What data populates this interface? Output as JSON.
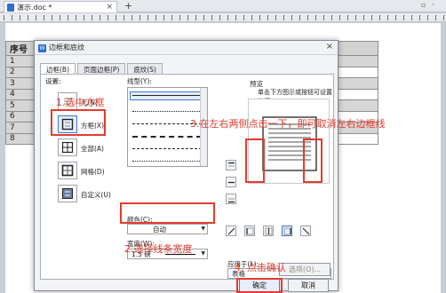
{
  "tabbar": {
    "doc_name": "演示.doc *",
    "new_tab": "+"
  },
  "document": {
    "header": [
      "序号",
      "",
      "",
      "",
      "",
      "数"
    ],
    "rows": [
      "1",
      "2",
      "3",
      "4",
      "5",
      "6",
      "7",
      "8"
    ]
  },
  "dialog": {
    "title": "边框和底纹",
    "tabs": [
      "边框(B)",
      "页面边框(P)",
      "底纹(S)"
    ],
    "settings_label": "设置:",
    "settings": [
      "无(N)",
      "方框(X)",
      "全部(A)",
      "网格(D)",
      "自定义(U)"
    ],
    "linestyle_label": "线型(Y):",
    "color_label": "颜色(C):",
    "color_value": "自动",
    "width_label": "宽度(W):",
    "width_value": "1.5 磅",
    "preview_label": "预览",
    "preview_hint": "单击下方图示或按钮可设置边框",
    "apply_label": "应用于(L):",
    "apply_value": "表格",
    "options_label": "选项(O)...",
    "ok_label": "确定",
    "cancel_label": "取消"
  },
  "annotations": {
    "step1": "1.选中方框",
    "step2": "2.选择线条宽度",
    "step3": "3.在左右两侧点击一下，即可取消左右边框线",
    "step4": "4. 点击确认"
  },
  "colors": {
    "annotation": "#e23b2e",
    "accent": "#3b78d8"
  }
}
